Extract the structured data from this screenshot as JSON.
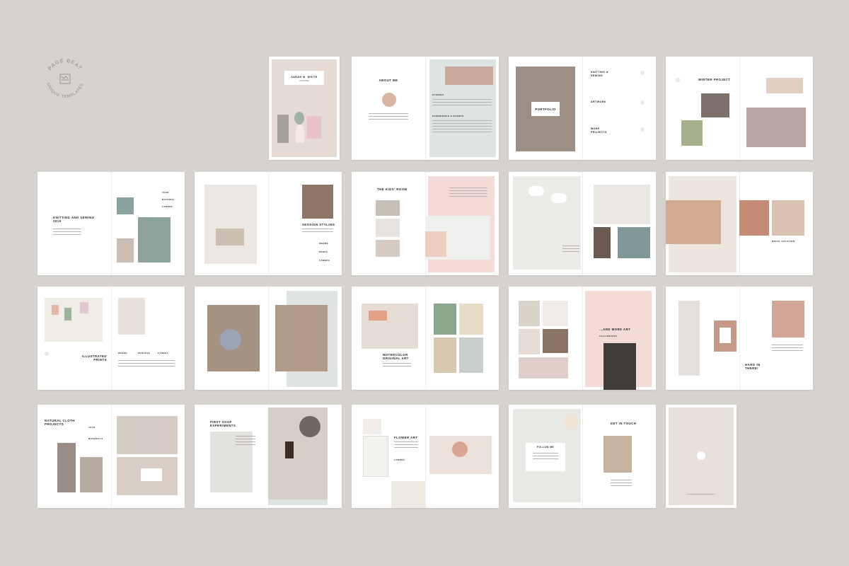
{
  "brand": {
    "logo_text_top": "PAGE BEAT",
    "logo_text_bottom": "UNIQUE TEMPLATES"
  },
  "colors": {
    "background": "#d6d2ce",
    "page": "#ffffff",
    "sage": "#dde4e1",
    "blush": "#f2dcd5",
    "sand": "#ece6df"
  },
  "spreads": [
    {
      "id": "cover",
      "title": "SARAH M. WHITE",
      "subtitle": "Art Portfolio"
    },
    {
      "id": "about",
      "title": "ABOUT ME",
      "side_title": "STUDIES",
      "side_title2": "EXPERIENCE & EVENTS"
    },
    {
      "id": "portfolio",
      "title": "PORTFOLIO",
      "menu": [
        "KNITTING & SEWING",
        "ARTWORK",
        "MORE PROJECTS"
      ]
    },
    {
      "id": "winter",
      "title": "WINTER PROJECT"
    },
    {
      "id": "knitting",
      "title": "KNITTING AND SEWING 2019",
      "labels": [
        "YEAR",
        "MATERIAL",
        "CAMERA"
      ]
    },
    {
      "id": "session",
      "title": "SESSION STYLING",
      "labels": [
        "WHERE",
        "PROPS",
        "CAMERA"
      ]
    },
    {
      "id": "kids",
      "title": "THE KIDS' ROOM"
    },
    {
      "id": "toys",
      "title": ""
    },
    {
      "id": "brick",
      "title": "BRICK VACATION"
    },
    {
      "id": "prints",
      "title": "ILLUSTRATED PRINTS",
      "labels": [
        "WHERE",
        "PROCESS",
        "CAMERA"
      ]
    },
    {
      "id": "floral",
      "title": ""
    },
    {
      "id": "watercolor",
      "title": "WATERCOLOR ORIGINAL ART"
    },
    {
      "id": "moreart",
      "title": "...AND MORE ART",
      "label": "CALLIGRAPHY"
    },
    {
      "id": "hang",
      "title": "HANG IN THERE!"
    },
    {
      "id": "cloth",
      "title": "NATURAL CLOTH PROJECTS",
      "labels": [
        "YEAR",
        "MATERIALS"
      ]
    },
    {
      "id": "soap",
      "title": "FIRST SOAP EXPERIMENTS"
    },
    {
      "id": "flower",
      "title": "FLOWER ART",
      "label": "CAMERA"
    },
    {
      "id": "contact",
      "title": "GET IN TOUCH",
      "subtitle": "FOLLOW ME"
    },
    {
      "id": "back",
      "title": ""
    }
  ]
}
